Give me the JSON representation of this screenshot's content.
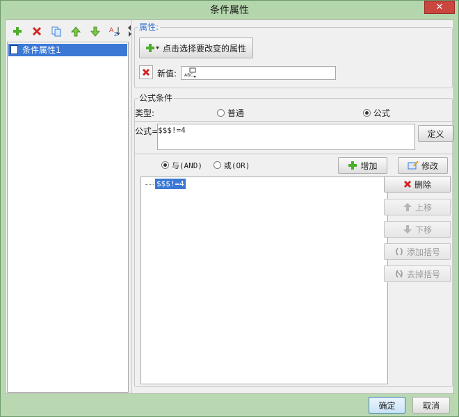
{
  "window": {
    "title": "条件属性",
    "close_label": "✕"
  },
  "left": {
    "toolbar": [
      {
        "name": "add-icon",
        "glyph": "+",
        "color": "#4caf2a"
      },
      {
        "name": "delete-icon",
        "glyph": "✖",
        "color": "#d32424"
      },
      {
        "name": "copy-icon",
        "glyph": "❐",
        "color": "#3a7bd5"
      },
      {
        "name": "move-up-icon",
        "glyph": "⬆",
        "color": "#5bb82e"
      },
      {
        "name": "move-down-icon",
        "glyph": "⬇",
        "color": "#5bb82e"
      },
      {
        "name": "sort-icon",
        "glyph": "A↕",
        "color": "#c03030"
      }
    ],
    "tree_item": "条件属性1"
  },
  "attributes": {
    "legend": "属性:",
    "select_button": "点击选择要改变的属性",
    "new_value_label": "新值:",
    "new_value": ""
  },
  "formula_condition": {
    "legend": "公式条件",
    "type_label": "类型:",
    "radio_normal": "普通",
    "radio_formula": "公式",
    "selected_type": "公式",
    "formula_label": "公式=",
    "formula_value": "$$$!=4",
    "define_button": "定义",
    "and_label": "与(AND)",
    "or_label": "或(OR)",
    "selected_logic": "AND",
    "add_button": "增加",
    "modify_button": "修改",
    "delete_button": "删除",
    "move_up_button": "上移",
    "move_down_button": "下移",
    "add_paren_button": "添加括号",
    "remove_paren_button": "去掉括号",
    "conditions": [
      "$$$!=4"
    ]
  },
  "footer": {
    "ok": "确定",
    "cancel": "取消"
  },
  "colors": {
    "accent": "#3b78d6",
    "frame": "#b9d8b2",
    "add_green": "#4caf2a",
    "delete_red": "#d32424"
  }
}
